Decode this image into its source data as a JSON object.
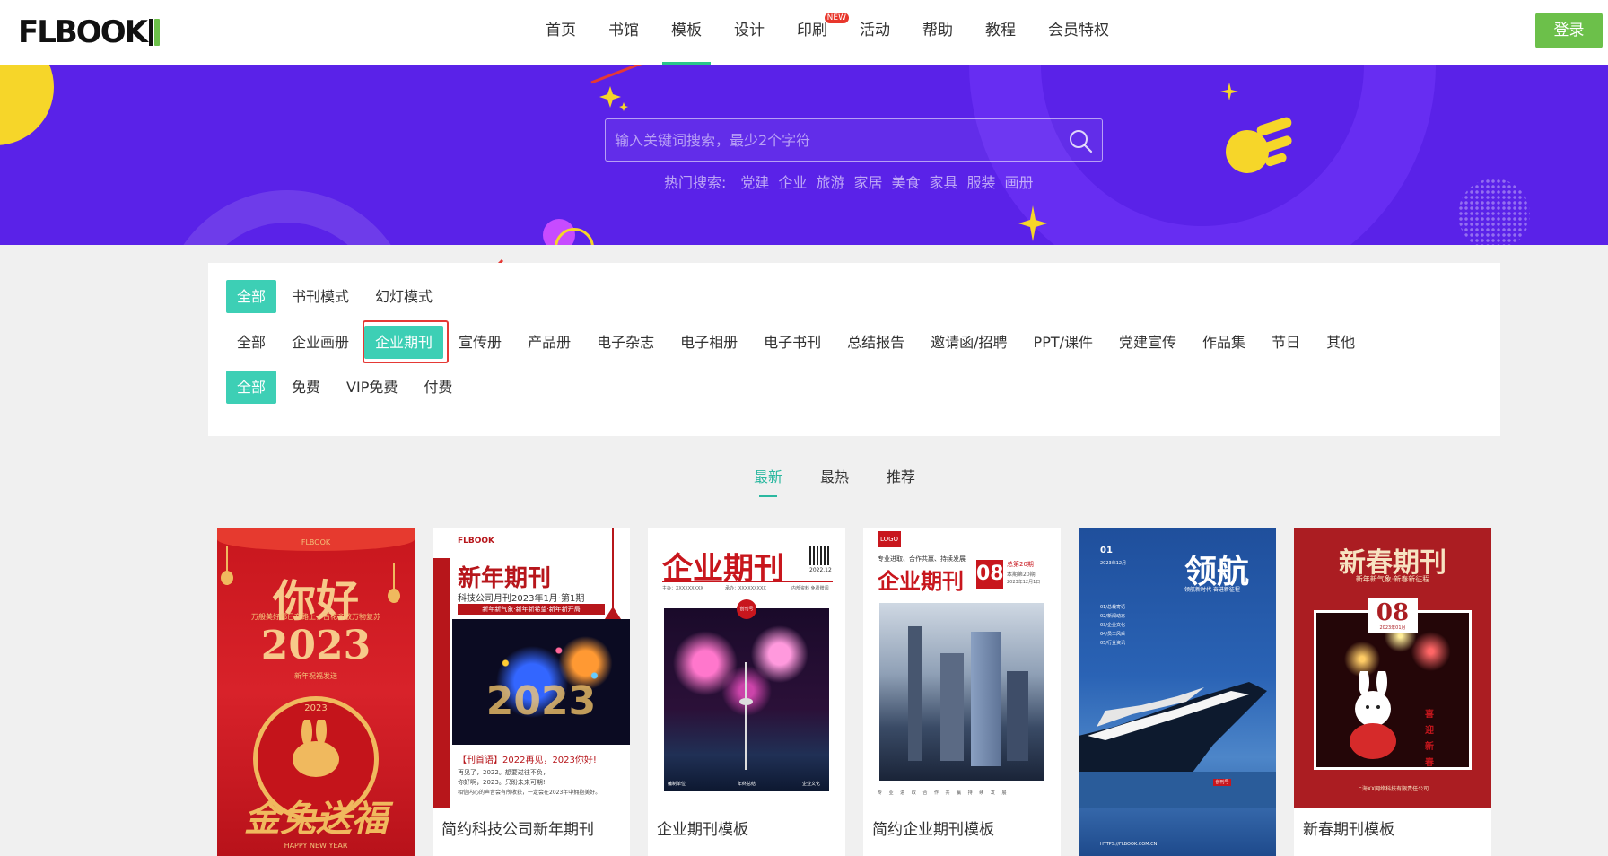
{
  "nav": {
    "logo": "FLBOOK",
    "items": [
      "首页",
      "书馆",
      "模板",
      "设计",
      "印刷",
      "活动",
      "帮助",
      "教程",
      "会员特权"
    ],
    "new_badge": "NEW",
    "login": "登录"
  },
  "banner": {
    "search_placeholder": "输入关键词搜索，最少2个字符",
    "hot_label": "热门搜索:",
    "hot_tags": [
      "党建",
      "企业",
      "旅游",
      "家居",
      "美食",
      "家具",
      "服装",
      "画册"
    ]
  },
  "filters": {
    "mode": [
      "全部",
      "书刊模式",
      "幻灯模式"
    ],
    "category": [
      "全部",
      "企业画册",
      "企业期刊",
      "宣传册",
      "产品册",
      "电子杂志",
      "电子相册",
      "电子书刊",
      "总结报告",
      "邀请函/招聘",
      "PPT/课件",
      "党建宣传",
      "作品集",
      "节日",
      "其他"
    ],
    "price": [
      "全部",
      "免费",
      "VIP免费",
      "付费"
    ]
  },
  "sort": [
    "最新",
    "最热",
    "推荐"
  ],
  "cards": [
    {
      "title": "",
      "cover": {
        "heading": "你好",
        "year": "2023",
        "year_small": "2023",
        "line1": "万般美好都已在路上，百花齐放万物复苏",
        "line2": "新年祝福发送",
        "brand": "FLBOOK",
        "calligraphy": "金兔送福",
        "footer": "HAPPY NEW YEAR"
      }
    },
    {
      "title": "简约科技公司新年期刊",
      "cover": {
        "brand": "FLBOOK",
        "heading": "新年期刊",
        "subtitle": "科技公司月刊2023年1月·第1期",
        "banner": "新年新气象·新年新希望·新年新开局",
        "year": "2023",
        "quote": "【刊首语】2022再见，2023你好!",
        "body1": "再见了，2022。想要过往不负，",
        "body2": "你好啊，2023。只盼未来可期!",
        "body3": "相信内心的声音会有所收获，一定会在2023年中拥抱美好。"
      }
    },
    {
      "title": "企业期刊模板",
      "cover": {
        "heading": "企业期刊",
        "date": "2022.12",
        "meta_left": "主办：XXXXXXXXX",
        "meta_mid": "承办：XXXXXXXXX",
        "meta_right": "内部资料  免费赠阅",
        "stamp": "创刊号",
        "foot_left": "编制单位",
        "foot_mid": "年终总结",
        "foot_right": "企业文化"
      }
    },
    {
      "title": "简约企业期刊模板",
      "cover": {
        "logo": "LOGO",
        "slogan": "专业进取、合作共赢、持续发展",
        "heading": "企业期刊",
        "number": "08",
        "issue": "总第20期",
        "issue2": "本期第20期",
        "date": "2023年12月1日",
        "footer": "专 业 进 取 合 作 共 赢 持 续 发 展"
      }
    },
    {
      "title": "",
      "cover": {
        "number": "01",
        "date": "2023年12月",
        "heading": "领航",
        "subheading": "领航新时代 奋进新征程",
        "list": [
          "01/总裁寄语",
          "02/新闻动态",
          "03/企业文化",
          "04/员工风采",
          "05/行业资讯"
        ],
        "badge": "创刊号",
        "footer": "HTTPS://FLBOOK.COM.CN"
      }
    },
    {
      "title": "新春期刊模板",
      "cover": {
        "heading": "新春期刊",
        "subtitle": "新年新气象·新春新征程",
        "number": "08",
        "date": "2023年01月",
        "couplet": "喜迎新春",
        "footer": "上海XX网络科技有限责任公司"
      }
    }
  ]
}
